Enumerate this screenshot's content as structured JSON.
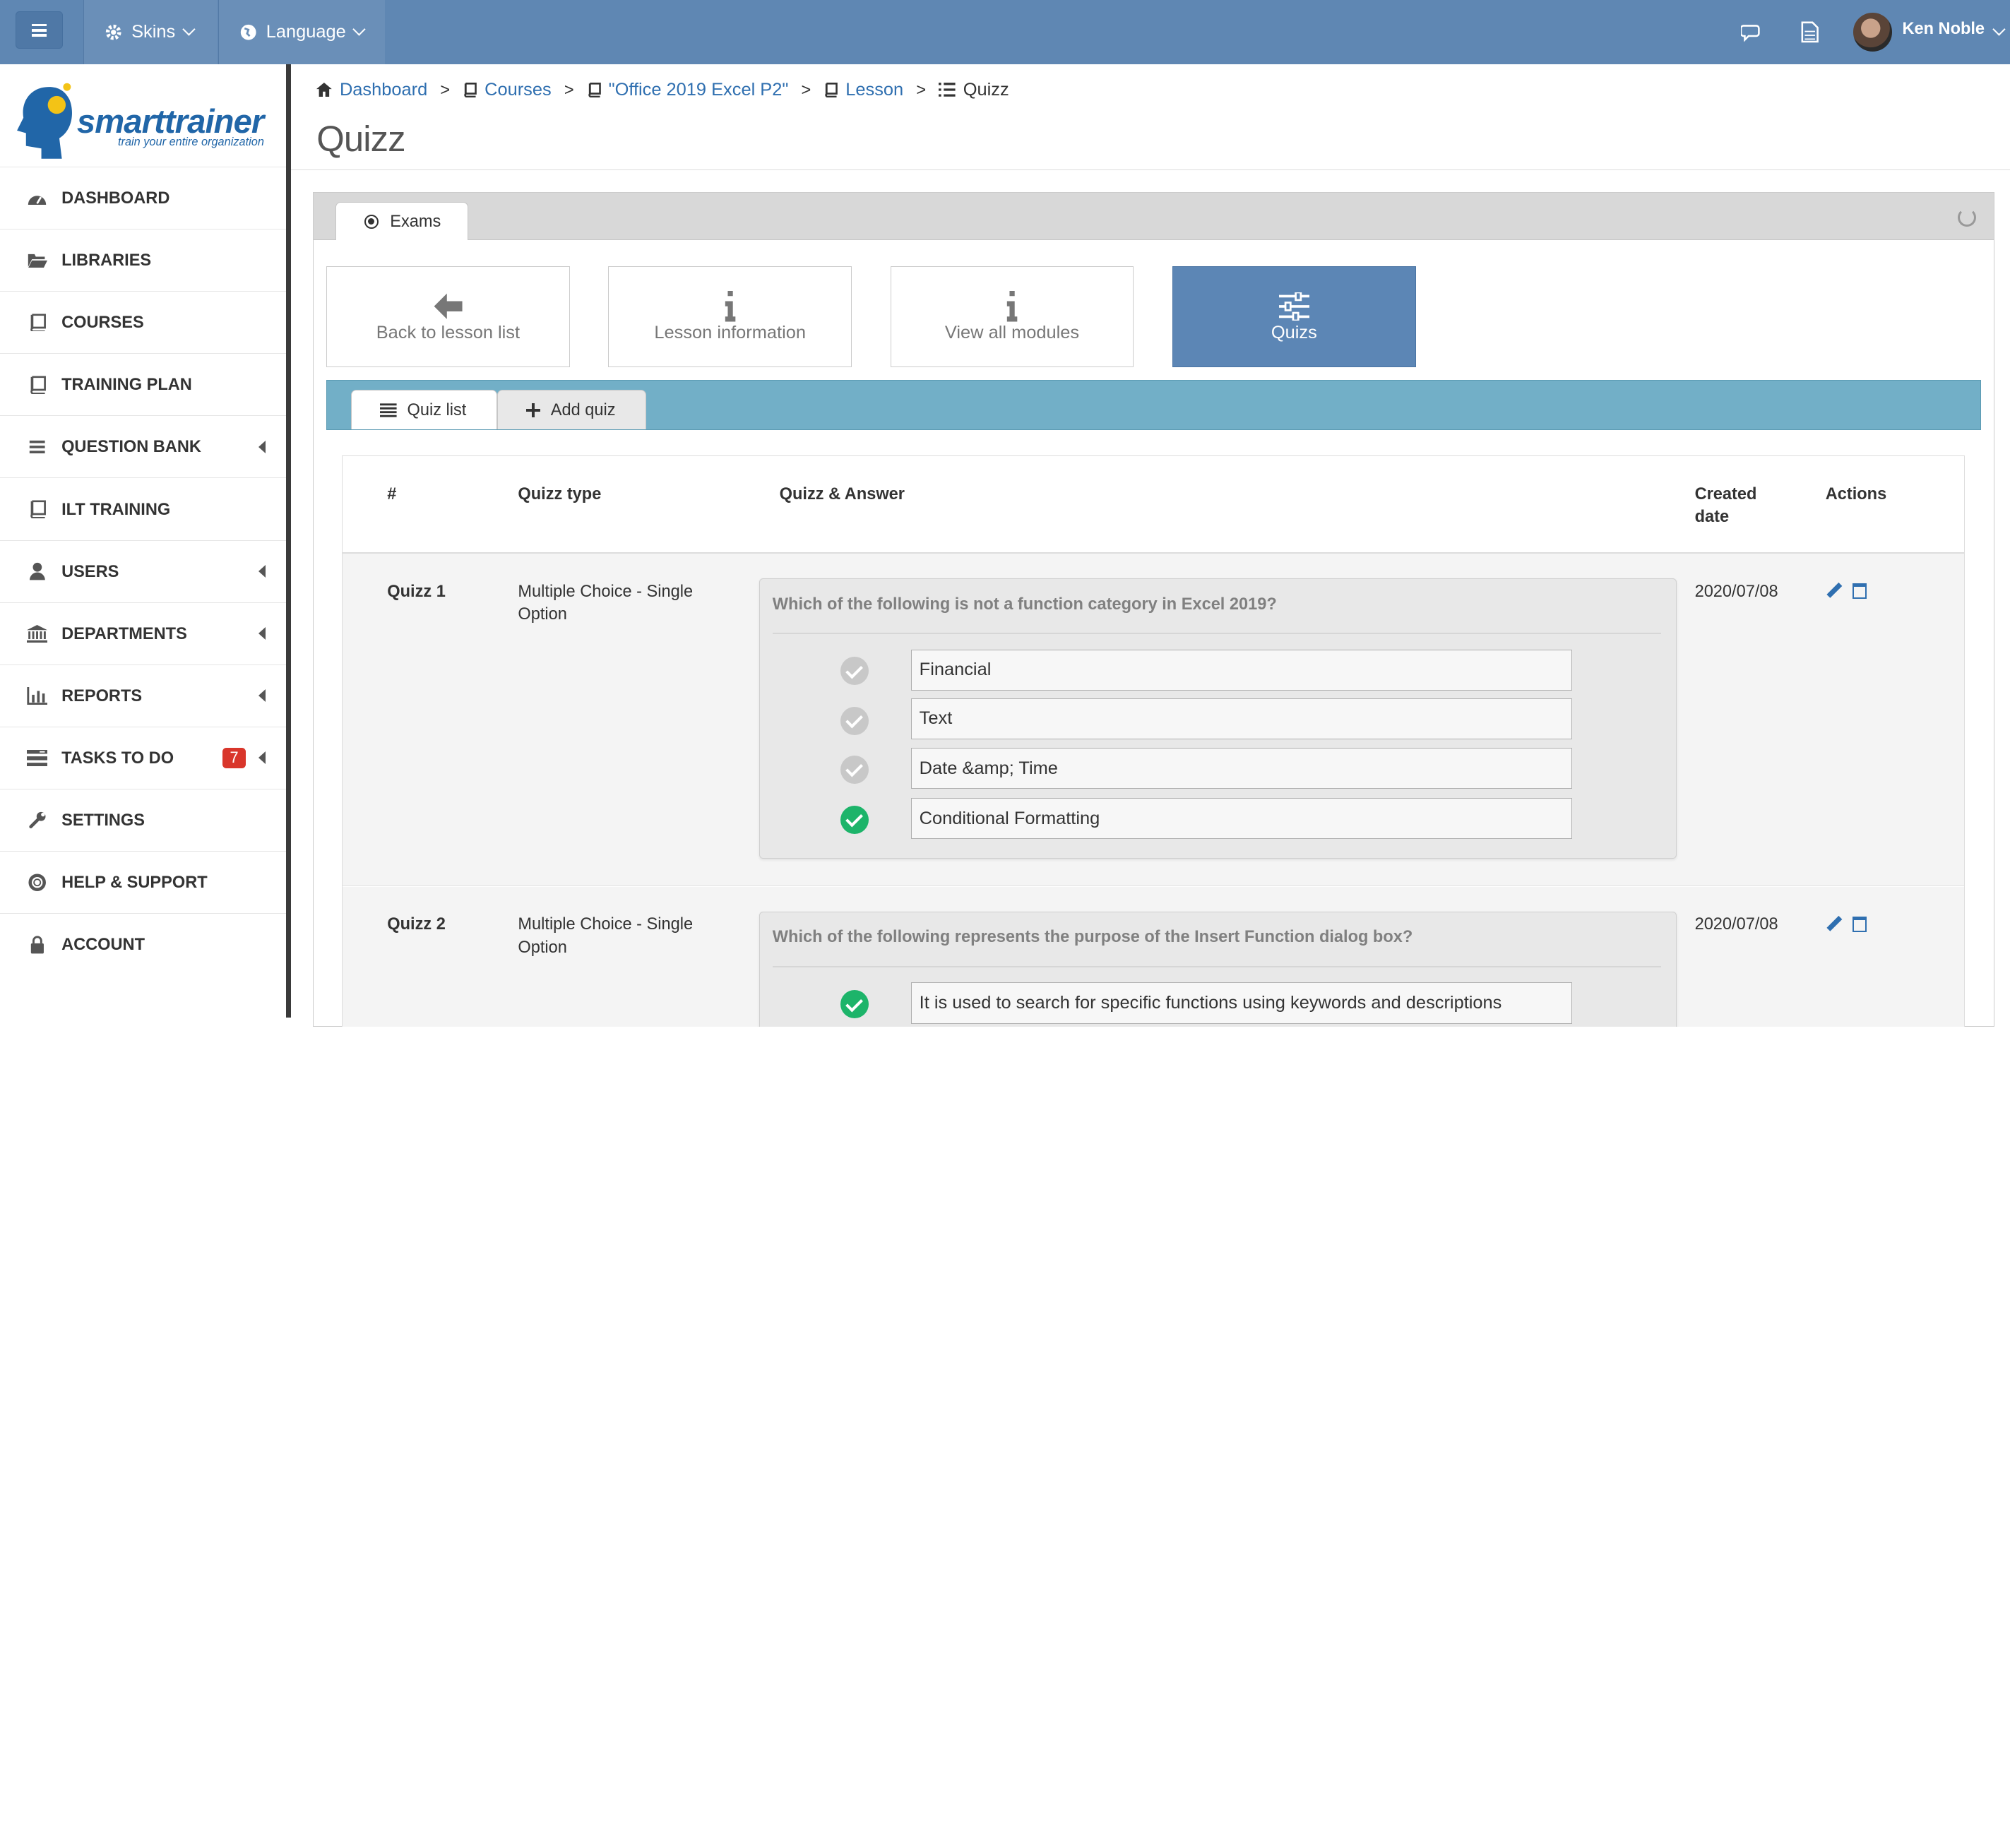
{
  "topbar": {
    "skins_label": "Skins",
    "language_label": "Language",
    "user_name": "Ken Noble",
    "colors": {
      "bar": "#5f87b3"
    }
  },
  "logo": {
    "name": "smarttrainer",
    "tagline": "train your entire organization"
  },
  "sidebar": {
    "items": [
      {
        "label": "DASHBOARD",
        "icon": "dashboard-icon"
      },
      {
        "label": "LIBRARIES",
        "icon": "folder-open-icon"
      },
      {
        "label": "COURSES",
        "icon": "book-icon"
      },
      {
        "label": "TRAINING PLAN",
        "icon": "book-icon"
      },
      {
        "label": "QUESTION BANK",
        "icon": "list-icon"
      },
      {
        "label": "ILT TRAINING",
        "icon": "book-icon"
      },
      {
        "label": "USERS",
        "icon": "user-icon"
      },
      {
        "label": "DEPARTMENTS",
        "icon": "bank-icon"
      },
      {
        "label": "REPORTS",
        "icon": "bar-chart-icon"
      },
      {
        "label": "TASKS TO DO",
        "icon": "tasks-icon",
        "badge": "7"
      },
      {
        "label": "SETTINGS",
        "icon": "wrench-icon"
      },
      {
        "label": "HELP & SUPPORT",
        "icon": "lifebuoy-icon"
      },
      {
        "label": "ACCOUNT",
        "icon": "lock-icon"
      }
    ]
  },
  "breadcrumb": {
    "dashboard": "Dashboard",
    "courses": "Courses",
    "course": "\"Office 2019 Excel P2\"",
    "lesson": "Lesson",
    "current": "Quizz"
  },
  "page": {
    "title": "Quizz"
  },
  "panel": {
    "tab_label": "Exams"
  },
  "actions": {
    "back": "Back to lesson list",
    "lesson_info": "Lesson information",
    "view_modules": "View all modules",
    "quizs": "Quizs"
  },
  "subtabs": {
    "quiz_list": "Quiz list",
    "add_quiz": "Add quiz"
  },
  "table": {
    "headers": {
      "num": "#",
      "type": "Quizz type",
      "qa": "Quizz & Answer",
      "created_1": "Created",
      "created_2": "date",
      "actions": "Actions"
    },
    "rows": [
      {
        "num": "Quizz 1",
        "type_1": "Multiple Choice - Single",
        "type_2": "Option",
        "question": "Which of the following is not a function category in Excel 2019?",
        "answers": [
          {
            "text": "Financial",
            "correct": false
          },
          {
            "text": "Text",
            "correct": false
          },
          {
            "text": "Date &amp; Time",
            "correct": false
          },
          {
            "text": "Conditional Formatting",
            "correct": true
          }
        ],
        "date": "2020/07/08"
      },
      {
        "num": "Quizz 2",
        "type_1": "Multiple Choice - Single",
        "type_2": "Option",
        "question": "Which of the following represents the purpose of the Insert Function dialog box?",
        "answers": [
          {
            "text": "It is used to search for specific functions using keywords and descriptions",
            "correct": true
          }
        ],
        "date": "2020/07/08"
      }
    ]
  }
}
